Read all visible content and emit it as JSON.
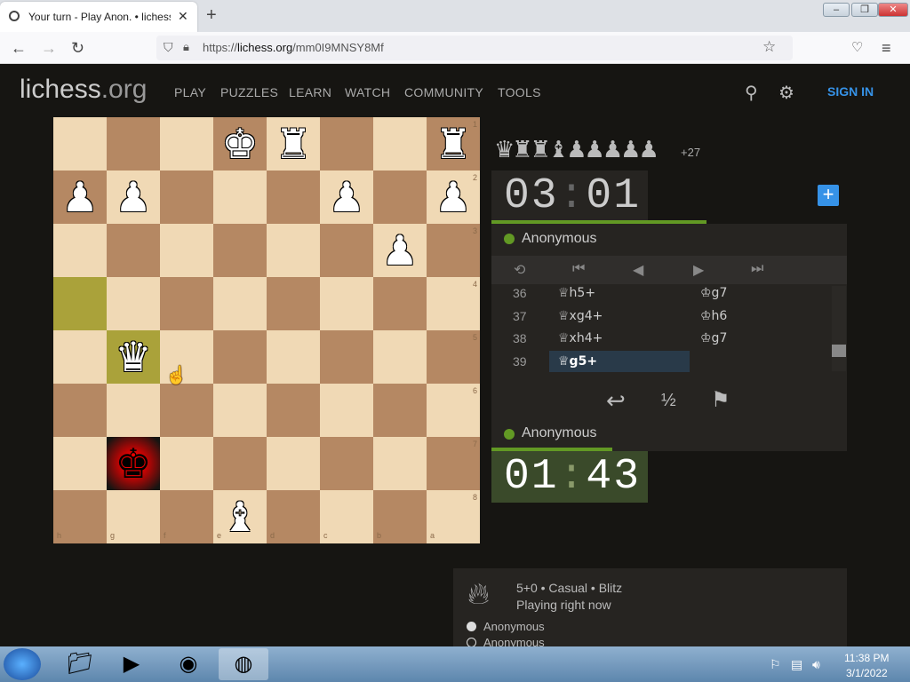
{
  "browser": {
    "tab_title": "Your turn - Play Anon. • lichess",
    "tab_close": "✕",
    "new_tab": "+",
    "url_prefix": "https://",
    "url_host": "lichess.org",
    "url_path": "/mm0I9MNSY8Mf",
    "window_controls": [
      "–",
      "❐",
      "✕"
    ]
  },
  "site": {
    "logo_main": "lichess",
    "logo_tld": ".org",
    "nav": [
      "PLAY",
      "PUZZLES",
      "LEARN",
      "WATCH",
      "COMMUNITY",
      "TOOLS"
    ],
    "sign_in": "SIGN IN"
  },
  "board": {
    "files_bottom": [
      "h",
      "g",
      "f",
      "e",
      "d",
      "c",
      "b",
      "a"
    ],
    "ranks_right": [
      "1",
      "2",
      "3",
      "4",
      "5",
      "6",
      "7",
      "8"
    ],
    "pieces": [
      {
        "square": "d1",
        "glyph": "♜",
        "color": "w"
      },
      {
        "square": "e1",
        "glyph": "♚",
        "color": "w"
      },
      {
        "square": "a1",
        "glyph": "♜",
        "color": "w"
      },
      {
        "square": "h2",
        "glyph": "♟",
        "color": "w"
      },
      {
        "square": "g2",
        "glyph": "♟",
        "color": "w"
      },
      {
        "square": "c2",
        "glyph": "♟",
        "color": "w"
      },
      {
        "square": "a2",
        "glyph": "♟",
        "color": "w"
      },
      {
        "square": "b3",
        "glyph": "♟",
        "color": "w"
      },
      {
        "square": "g5",
        "glyph": "♛",
        "color": "w"
      },
      {
        "square": "g7",
        "glyph": "♚",
        "color": "b"
      },
      {
        "square": "e8",
        "glyph": "♝",
        "color": "w"
      }
    ],
    "highlight_squares": [
      "h4",
      "g5"
    ],
    "check_square": "g7"
  },
  "panel": {
    "material_glyphs": "♛♜♜♝♟♟♟♟♟",
    "material_diff": "+27",
    "top_clock_min": "03",
    "top_clock_sec": "01",
    "top_player": "Anonymous",
    "bottom_player": "Anonymous",
    "bottom_clock_min": "01",
    "bottom_clock_sec": "43",
    "controls": [
      "⟲",
      "⏮",
      "◀",
      "▶",
      "⏭"
    ],
    "moves": [
      {
        "num": "36",
        "white": "♕h5+",
        "black": "♔g7"
      },
      {
        "num": "37",
        "white": "♕xg4+",
        "black": "♔h6"
      },
      {
        "num": "38",
        "white": "♕xh4+",
        "black": "♔g7"
      },
      {
        "num": "39",
        "white": "♕g5+",
        "black": ""
      }
    ],
    "actions": [
      "↩",
      "½",
      "⚑"
    ]
  },
  "game_info": {
    "setup": "5+0 • Casual • Blitz",
    "status": "Playing right now",
    "players": [
      "Anonymous",
      "Anonymous"
    ]
  },
  "taskbar": {
    "time": "11:38 PM",
    "date": "3/1/2022"
  },
  "colors": {
    "board_light": "#f0d9b5",
    "board_dark": "#b58863",
    "accent_green": "#629924",
    "link_blue": "#3692e7"
  }
}
